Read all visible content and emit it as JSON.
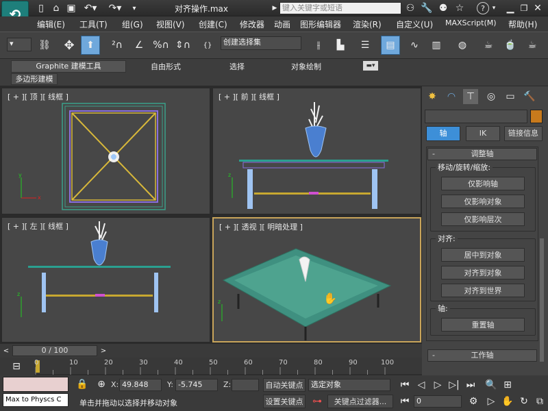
{
  "window": {
    "title": "对齐操作.max",
    "search_placeholder": "键入关键字或短语"
  },
  "menu": [
    "编辑(E)",
    "工具(T)",
    "组(G)",
    "视图(V)",
    "创建(C)",
    "修改器",
    "动画",
    "图形编辑器",
    "渲染(R)",
    "自定义(U)",
    "MAXScript(M)",
    "帮助(H)"
  ],
  "toolbar": {
    "selection_set": "创建选择集"
  },
  "ribbon": {
    "tabs": [
      "Graphite 建模工具",
      "自由形式",
      "选择",
      "对象绘制"
    ],
    "sub_tab": "多边形建模"
  },
  "viewports": {
    "top": "[ + ][ 顶 ][ 线框 ]",
    "front": "[ + ][ 前 ][ 线框 ]",
    "left": "[ + ][ 左 ][ 线框 ]",
    "persp": "[ + ][ 透视 ][ 明暗处理 ]"
  },
  "cmdpanel": {
    "tabs": [
      "轴",
      "IK",
      "链接信息"
    ],
    "rollout_adjust": "调整轴",
    "group_move": "移动/旋转/缩放:",
    "btn_pivot_only": "仅影响轴",
    "btn_object_only": "仅影响对象",
    "btn_hierarchy_only": "仅影响层次",
    "group_align": "对齐:",
    "btn_center": "居中到对象",
    "btn_align_obj": "对齐到对象",
    "btn_align_world": "对齐到世界",
    "group_pivot": "轴:",
    "btn_reset": "重置轴",
    "rollout_working": "工作轴"
  },
  "timeline": {
    "frame": "0 / 100",
    "ticks": [
      "0",
      "10",
      "20",
      "30",
      "40",
      "50",
      "60",
      "70",
      "80",
      "90",
      "100"
    ]
  },
  "status": {
    "maxscript": "Max to Physcs C",
    "prompt": "单击并拖动以选择并移动对象",
    "x_label": "X:",
    "x_value": "49.848",
    "y_label": "Y:",
    "y_value": "-5.745",
    "z_label": "Z:",
    "auto_key": "自动关键点",
    "selected": "选定对象",
    "set_key": "设置关键点",
    "key_filter": "关键点过滤器...",
    "frame_field": "0"
  },
  "colors": {
    "active_border": "#c9a55a",
    "tab_blue": "#3d8fd8",
    "glass": "#3f9080"
  }
}
